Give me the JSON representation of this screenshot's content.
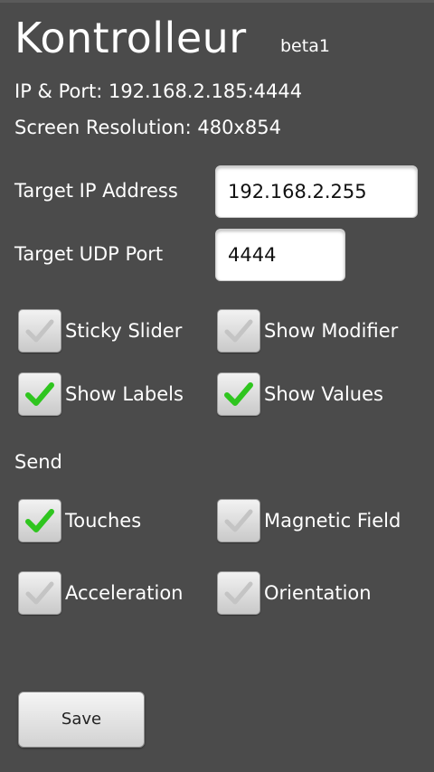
{
  "app": {
    "title": "Kontrolleur",
    "version": "beta1"
  },
  "info": {
    "ip_port": "IP & Port: 192.168.2.185:4444",
    "screen_resolution": "Screen Resolution: 480x854"
  },
  "form": {
    "target_ip_label": "Target IP Address",
    "target_ip_value": "192.168.2.255",
    "target_port_label": "Target UDP Port",
    "target_port_value": "4444"
  },
  "options": {
    "sticky_slider": {
      "label": "Sticky Slider",
      "checked": false
    },
    "show_modifier": {
      "label": "Show Modifier",
      "checked": false
    },
    "show_labels": {
      "label": "Show Labels",
      "checked": true
    },
    "show_values": {
      "label": "Show Values",
      "checked": true
    }
  },
  "send": {
    "heading": "Send",
    "touches": {
      "label": "Touches",
      "checked": true
    },
    "magnetic_field": {
      "label": "Magnetic Field",
      "checked": false
    },
    "acceleration": {
      "label": "Acceleration",
      "checked": false
    },
    "orientation": {
      "label": "Orientation",
      "checked": false
    }
  },
  "actions": {
    "save_label": "Save"
  },
  "colors": {
    "background": "#4b4b4b",
    "check_on": "#2fc51f",
    "check_off": "#c4c4c4"
  },
  "icons": {
    "checkbox_checked": "green-checkmark",
    "checkbox_unchecked": "gray-checkmark"
  }
}
